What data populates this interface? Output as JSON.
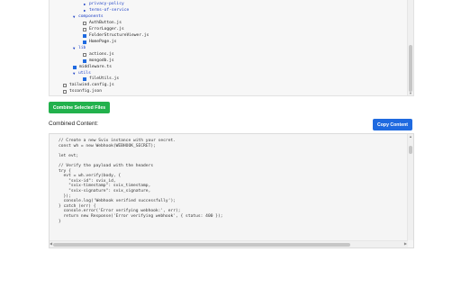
{
  "file_tree": {
    "items": [
      {
        "label": "privacy-policy",
        "kind": "folder"
      },
      {
        "label": "terms-of-service",
        "kind": "folder"
      },
      {
        "label": "components",
        "kind": "folder-open"
      },
      {
        "label": "AuthButton.js",
        "kind": "file",
        "checked": false
      },
      {
        "label": "ErrorLogger.js",
        "kind": "file",
        "checked": false
      },
      {
        "label": "FolderStructureViewer.js",
        "kind": "file",
        "checked": true
      },
      {
        "label": "HomePage.js",
        "kind": "file",
        "checked": true
      },
      {
        "label": "lib",
        "kind": "folder-open"
      },
      {
        "label": "actions.js",
        "kind": "file",
        "checked": false
      },
      {
        "label": "mongodb.js",
        "kind": "file",
        "checked": true
      },
      {
        "label": "middleware.ts",
        "kind": "file",
        "checked": true
      },
      {
        "label": "utils",
        "kind": "folder-open"
      },
      {
        "label": "fileUtils.js",
        "kind": "file",
        "checked": true
      },
      {
        "label": "tailwind.config.js",
        "kind": "file",
        "checked": false
      },
      {
        "label": "tsconfig.json",
        "kind": "file",
        "checked": false
      }
    ]
  },
  "actions": {
    "combine_label": "Combine Selected Files",
    "copy_label": "Copy Content"
  },
  "combined": {
    "label": "Combined Content:",
    "lines": [
      "// Create a new Svix instance with your secret.",
      "const wh = new Webhook(WEBHOOK_SECRET);",
      "",
      "let evt;",
      "",
      "// Verify the payload with the headers",
      "try {",
      "  evt = wh.verify(body, {",
      "    \"svix-id\": svix_id,",
      "    \"svix-timestamp\": svix_timestamp,",
      "    \"svix-signature\": svix_signature,",
      "  });",
      "  console.log('Webhook verified successfully');",
      "} catch (err) {",
      "  console.error('Error verifying webhook:', err);",
      "  return new Response('Error verifying webhook', { status: 400 });",
      "}"
    ]
  },
  "colors": {
    "combine_button": "#22b14c",
    "copy_button": "#1f6ae0",
    "folder_text": "#1a3ec4",
    "checkbox_checked": "#1f6ae0"
  },
  "icons": {
    "folder_closed": "triangle-right-icon",
    "folder_open": "triangle-down-icon",
    "checkbox": "checkbox-icon"
  }
}
